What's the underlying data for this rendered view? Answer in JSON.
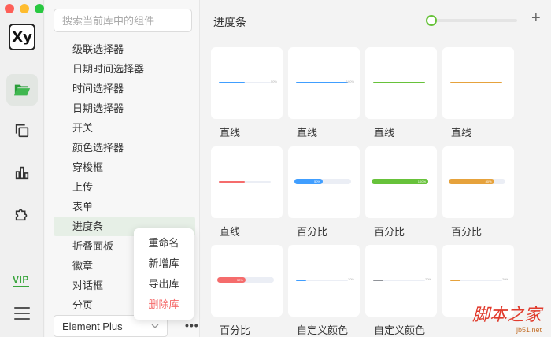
{
  "rail": {
    "logo": "Xy",
    "vip": "VIP"
  },
  "search": {
    "placeholder": "搜索当前库中的组件"
  },
  "components": [
    "级联选择器",
    "日期时间选择器",
    "时间选择器",
    "日期选择器",
    "开关",
    "颜色选择器",
    "穿梭框",
    "上传",
    "表单",
    "进度条",
    "折叠面板",
    "徽章",
    "对话框",
    "分页"
  ],
  "selected_component": "进度条",
  "library_select": {
    "value": "Element Plus"
  },
  "more_label": "•••",
  "context_menu": {
    "rename": "重命名",
    "new_lib": "新增库",
    "export_lib": "导出库",
    "delete_lib": "删除库"
  },
  "main": {
    "title": "进度条",
    "add_label": "+",
    "zoom_level": 0
  },
  "cards": [
    {
      "label": "直线",
      "style": "line",
      "color": "#409eff",
      "progress": 0.5,
      "text": "50%"
    },
    {
      "label": "直线",
      "style": "line",
      "color": "#409eff",
      "progress": 1.0,
      "text": "100%"
    },
    {
      "label": "直线",
      "style": "line",
      "color": "#67c23a",
      "progress": 1.0,
      "text": ""
    },
    {
      "label": "直线",
      "style": "line",
      "color": "#e6a23c",
      "progress": 1.0,
      "text": ""
    },
    {
      "label": "直线",
      "style": "line",
      "color": "#f56c6c",
      "progress": 0.5,
      "text": ""
    },
    {
      "label": "百分比",
      "style": "thick",
      "color": "#409eff",
      "progress": 0.5,
      "text": "50%"
    },
    {
      "label": "百分比",
      "style": "thick",
      "color": "#67c23a",
      "progress": 1.0,
      "text": "100%"
    },
    {
      "label": "百分比",
      "style": "thick",
      "color": "#e6a23c",
      "progress": 0.8,
      "text": "80%"
    },
    {
      "label": "百分比",
      "style": "thick",
      "color": "#f56c6c",
      "progress": 0.5,
      "text": "50%"
    },
    {
      "label": "自定义颜色",
      "style": "line",
      "color": "#409eff",
      "progress": 0.2,
      "text": "20%"
    },
    {
      "label": "自定义颜色",
      "style": "line",
      "color": "#909399",
      "progress": 0.2,
      "text": "20%"
    },
    {
      "label": "",
      "style": "line",
      "color": "#e6a23c",
      "progress": 0.2,
      "text": "20%"
    }
  ],
  "watermark": {
    "big": "脚本之家",
    "small": "jb51.net"
  }
}
